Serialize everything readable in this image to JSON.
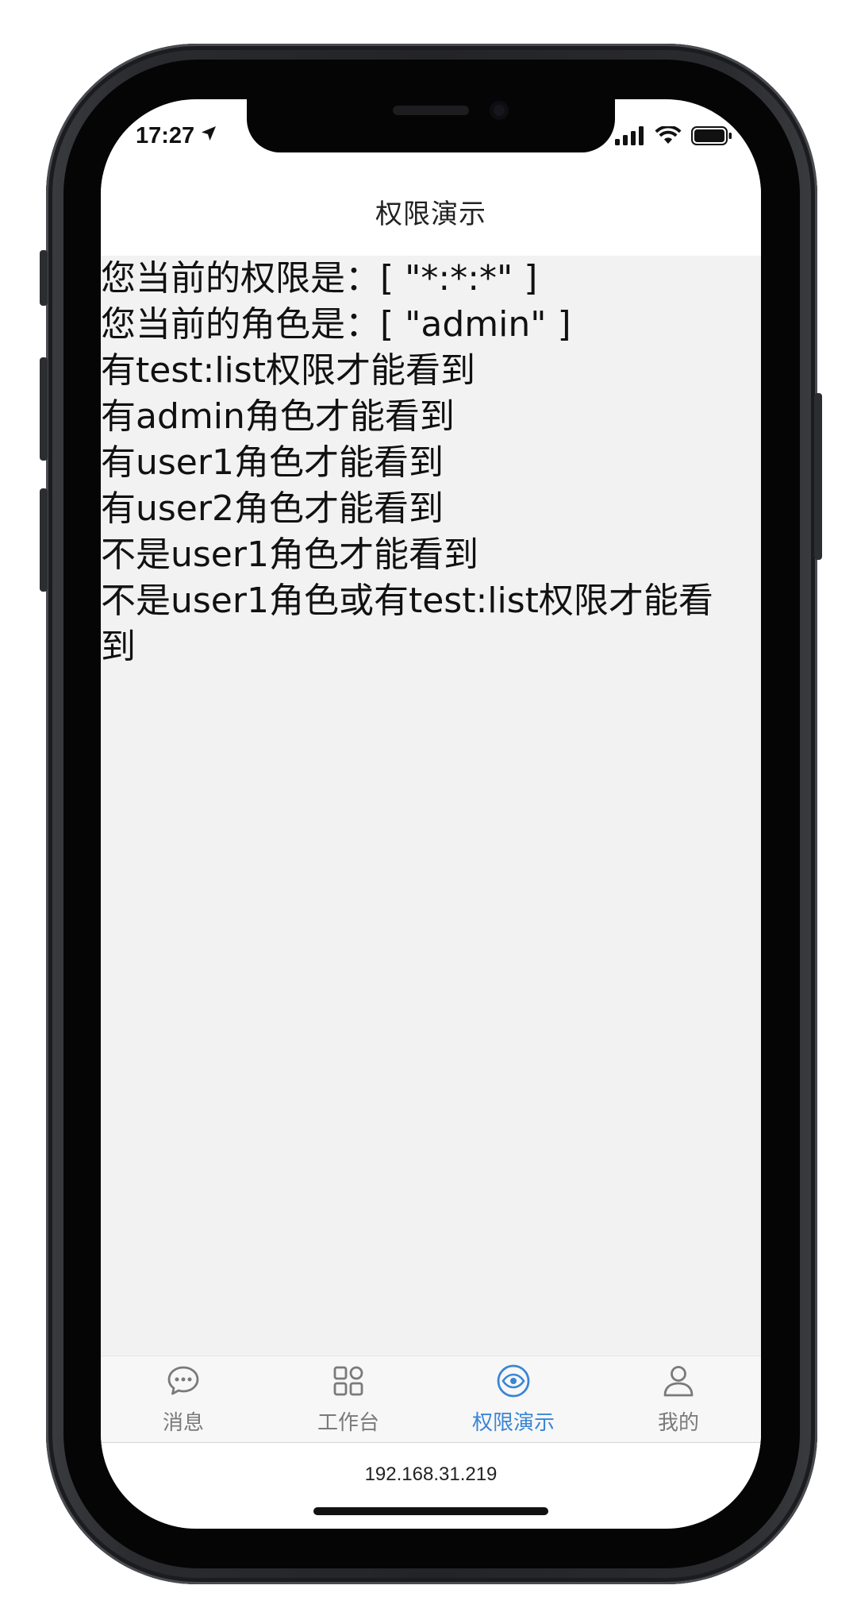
{
  "status_bar": {
    "time": "17:27"
  },
  "nav_bar": {
    "title": "权限演示"
  },
  "content": {
    "lines": [
      "您当前的权限是：[ \"*:*:*\" ]",
      "您当前的角色是：[ \"admin\" ]",
      "有test:list权限才能看到",
      "有admin角色才能看到",
      "有user1角色才能看到",
      "有user2角色才能看到",
      "不是user1角色才能看到",
      "不是user1角色或有test:list权限才能看到"
    ]
  },
  "tabbar": {
    "items": [
      {
        "label": "消息",
        "icon": "chat-bubble-icon",
        "active": false
      },
      {
        "label": "工作台",
        "icon": "grid-icon",
        "active": false
      },
      {
        "label": "权限演示",
        "icon": "eye-icon",
        "active": true
      },
      {
        "label": "我的",
        "icon": "person-icon",
        "active": false
      }
    ]
  },
  "url_bar": {
    "host": "192.168.31.219"
  },
  "colors": {
    "active_tab": "#3a86d6",
    "inactive_tab": "#7a7a7a",
    "content_bg": "#f2f2f2"
  }
}
